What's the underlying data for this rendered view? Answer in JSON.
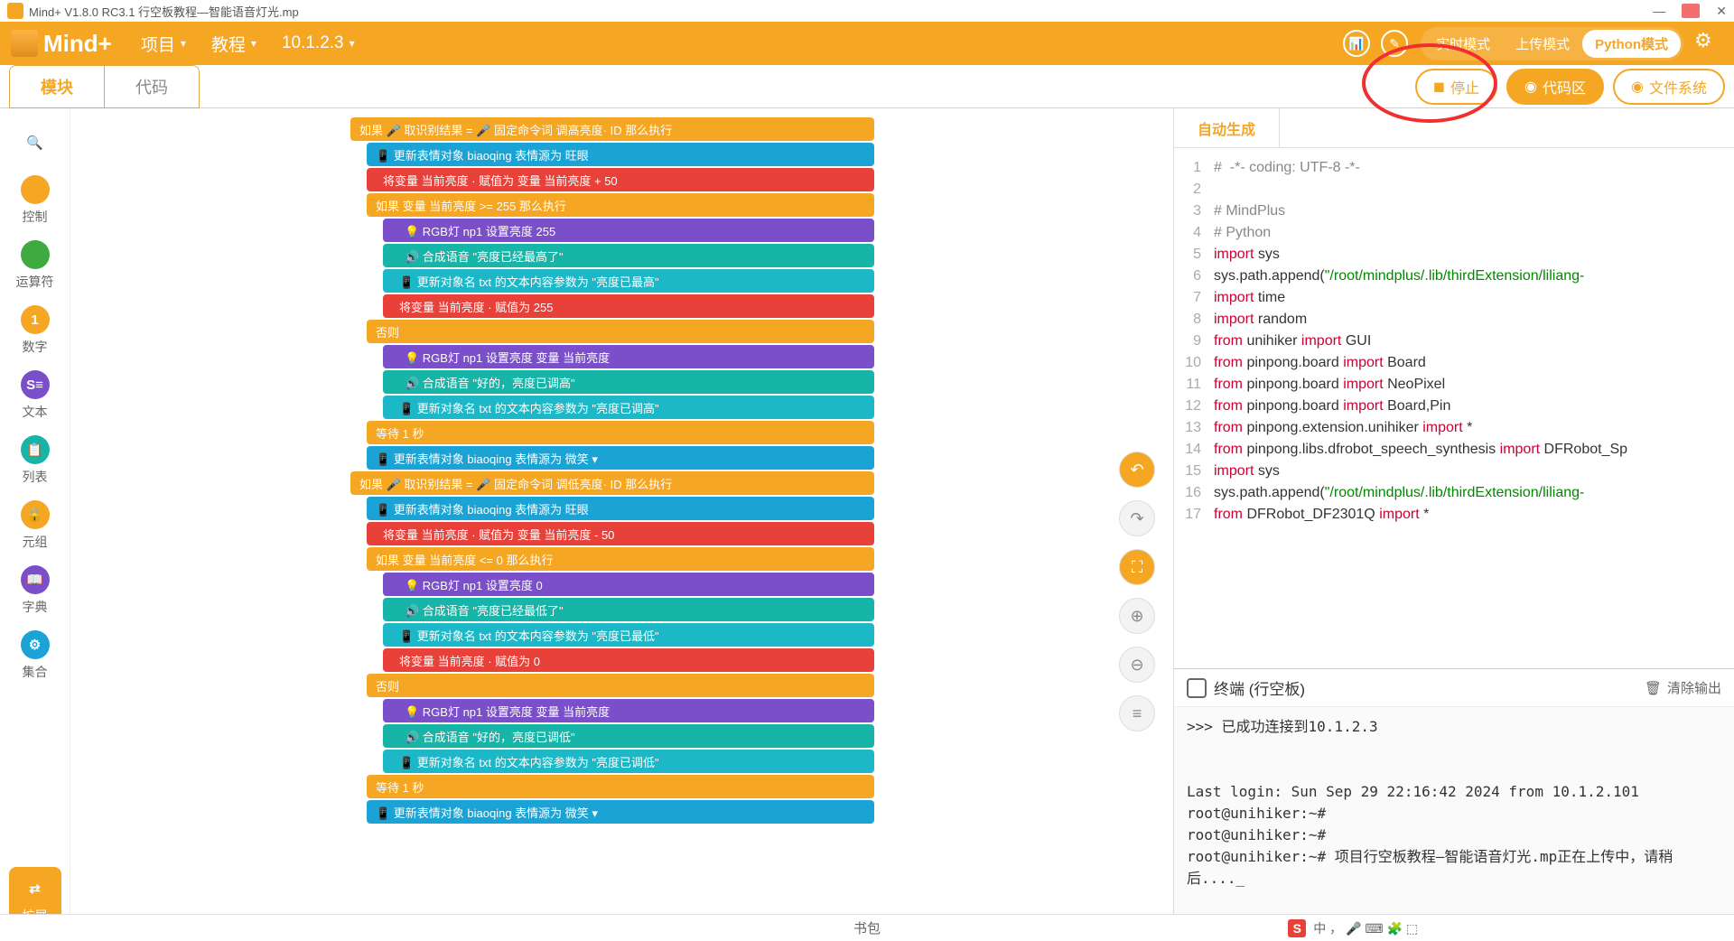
{
  "title": "Mind+ V1.8.0 RC3.1  行空板教程—智能语音灯光.mp",
  "menubar": {
    "logo": "Mind+",
    "project": "项目",
    "tutorial": "教程",
    "ip": "10.1.2.3"
  },
  "modes": {
    "realtime": "实时模式",
    "upload": "上传模式",
    "python": "Python模式"
  },
  "subtabs": {
    "blocks": "模块",
    "code": "代码"
  },
  "rbtns": {
    "stop": "停止",
    "codearea": "代码区",
    "filesys": "文件系统"
  },
  "categories": [
    {
      "label": "",
      "icon": "🔍",
      "color": "#fff",
      "iconcolor": "#f5a623"
    },
    {
      "label": "控制",
      "icon": "",
      "color": "#f5a623"
    },
    {
      "label": "运算符",
      "icon": "",
      "color": "#3faa3f"
    },
    {
      "label": "数字",
      "icon": "1",
      "color": "#f5a623"
    },
    {
      "label": "文本",
      "icon": "S≡",
      "color": "#7a4fc9"
    },
    {
      "label": "列表",
      "icon": "📋",
      "color": "#17b5a8"
    },
    {
      "label": "元组",
      "icon": "🔒",
      "color": "#f5a623"
    },
    {
      "label": "字典",
      "icon": "📖",
      "color": "#7a4fc9"
    },
    {
      "label": "集合",
      "icon": "⚙",
      "color": "#1aa3d4"
    }
  ],
  "ext_label": "扩展",
  "blocks": [
    {
      "cls": "c-orange",
      "txt": "如果  🎤 取识别结果  =  🎤 固定命令词 调高亮度· ID  那么执行"
    },
    {
      "cls": "c-blue indent1",
      "txt": "📱 更新表情对象 biaoqing 表情源为 旺眼"
    },
    {
      "cls": "c-red indent1",
      "txt": "将变量 当前亮度 · 赋值为 变量 当前亮度 + 50"
    },
    {
      "cls": "c-orange indent1",
      "txt": "如果  变量 当前亮度 >= 255  那么执行"
    },
    {
      "cls": "c-purple indent2",
      "txt": "💡 RGB灯 np1 设置亮度 255"
    },
    {
      "cls": "c-teal indent2",
      "txt": "🔊 合成语音 \"亮度已经最高了\""
    },
    {
      "cls": "c-cyan indent2",
      "txt": "📱 更新对象名 txt 的文本内容参数为 \"亮度已最高\""
    },
    {
      "cls": "c-red indent2",
      "txt": "将变量 当前亮度 · 赋值为 255"
    },
    {
      "cls": "c-orange indent1",
      "txt": "否则"
    },
    {
      "cls": "c-purple indent2",
      "txt": "💡 RGB灯 np1 设置亮度 变量 当前亮度"
    },
    {
      "cls": "c-teal indent2",
      "txt": "🔊 合成语音 \"好的，亮度已调高\""
    },
    {
      "cls": "c-cyan indent2",
      "txt": "📱 更新对象名 txt 的文本内容参数为 \"亮度已调高\""
    },
    {
      "cls": "c-orange indent1",
      "txt": "等待 1 秒"
    },
    {
      "cls": "c-blue indent1",
      "txt": "📱 更新表情对象 biaoqing 表情源为 微笑 ▾"
    },
    {
      "cls": "c-orange",
      "txt": "如果  🎤 取识别结果  =  🎤 固定命令词 调低亮度· ID  那么执行"
    },
    {
      "cls": "c-blue indent1",
      "txt": "📱 更新表情对象 biaoqing 表情源为 旺眼"
    },
    {
      "cls": "c-red indent1",
      "txt": "将变量 当前亮度 · 赋值为 变量 当前亮度 - 50"
    },
    {
      "cls": "c-orange indent1",
      "txt": "如果  变量 当前亮度 <= 0  那么执行"
    },
    {
      "cls": "c-purple indent2",
      "txt": "💡 RGB灯 np1 设置亮度 0"
    },
    {
      "cls": "c-teal indent2",
      "txt": "🔊 合成语音 \"亮度已经最低了\""
    },
    {
      "cls": "c-cyan indent2",
      "txt": "📱 更新对象名 txt 的文本内容参数为 \"亮度已最低\""
    },
    {
      "cls": "c-red indent2",
      "txt": "将变量 当前亮度 · 赋值为 0"
    },
    {
      "cls": "c-orange indent1",
      "txt": "否则"
    },
    {
      "cls": "c-purple indent2",
      "txt": "💡 RGB灯 np1 设置亮度 变量 当前亮度"
    },
    {
      "cls": "c-teal indent2",
      "txt": "🔊 合成语音 \"好的，亮度已调低\""
    },
    {
      "cls": "c-cyan indent2",
      "txt": "📱 更新对象名 txt 的文本内容参数为 \"亮度已调低\""
    },
    {
      "cls": "c-orange indent1",
      "txt": "等待 1 秒"
    },
    {
      "cls": "c-blue indent1",
      "txt": "📱 更新表情对象 biaoqing 表情源为 微笑 ▾"
    }
  ],
  "rtab": "自动生成",
  "code": [
    {
      "n": 1,
      "h": "<span class='tok-cm'>#  -*- coding: UTF-8 -*-</span>"
    },
    {
      "n": 2,
      "h": ""
    },
    {
      "n": 3,
      "h": "<span class='tok-cm'># MindPlus</span>"
    },
    {
      "n": 4,
      "h": "<span class='tok-cm'># Python</span>"
    },
    {
      "n": 5,
      "h": "<span class='tok-kw'>import</span> sys"
    },
    {
      "n": 6,
      "h": "sys.path.append(<span class='tok-st'>\"/root/mindplus/.lib/thirdExtension/liliang-</span>"
    },
    {
      "n": 7,
      "h": "<span class='tok-kw'>import</span> time"
    },
    {
      "n": 8,
      "h": "<span class='tok-kw'>import</span> random"
    },
    {
      "n": 9,
      "h": "<span class='tok-kw'>from</span> unihiker <span class='tok-kw'>import</span> GUI"
    },
    {
      "n": 10,
      "h": "<span class='tok-kw'>from</span> pinpong.board <span class='tok-kw'>import</span> Board"
    },
    {
      "n": 11,
      "h": "<span class='tok-kw'>from</span> pinpong.board <span class='tok-kw'>import</span> NeoPixel"
    },
    {
      "n": 12,
      "h": "<span class='tok-kw'>from</span> pinpong.board <span class='tok-kw'>import</span> Board,Pin"
    },
    {
      "n": 13,
      "h": "<span class='tok-kw'>from</span> pinpong.extension.unihiker <span class='tok-kw'>import</span> *"
    },
    {
      "n": 14,
      "h": "<span class='tok-kw'>from</span> pinpong.libs.dfrobot_speech_synthesis <span class='tok-kw'>import</span> DFRobot_Sp"
    },
    {
      "n": 15,
      "h": "<span class='tok-kw'>import</span> sys"
    },
    {
      "n": 16,
      "h": "sys.path.append(<span class='tok-st'>\"/root/mindplus/.lib/thirdExtension/liliang-</span>"
    },
    {
      "n": 17,
      "h": "<span class='tok-kw'>from</span> DFRobot_DF2301Q <span class='tok-kw'>import</span> *"
    }
  ],
  "terminal": {
    "title": "终端 (行空板)",
    "clear": "清除输出",
    "body": ">>> 已成功连接到10.1.2.3\n\n\nLast login: Sun Sep 29 22:16:42 2024 from 10.1.2.101\nroot@unihiker:~#\nroot@unihiker:~#\nroot@unihiker:~# 项目行空板教程—智能语音灯光.mp正在上传中，请稍后...._"
  },
  "footer": "书包",
  "ime": "中 ， 🎤 ⌨ 🧩 ⬚"
}
